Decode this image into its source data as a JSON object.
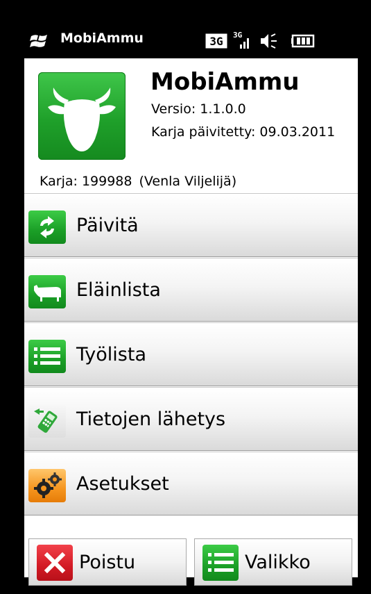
{
  "statusbar": {
    "title": "MobiAmmu",
    "icons": [
      "windows-logo",
      "3g-icon",
      "signal-3g-icon",
      "volume-icon",
      "battery-icon"
    ]
  },
  "app": {
    "name": "MobiAmmu",
    "version_label": "Versio: 1.1.0.0",
    "updated_label": "Karja päivitetty: 09.03.2011",
    "herd_label": "Karja: 199988",
    "herd_owner": "(Venla Viljelijä)",
    "icon": "cow-head-icon"
  },
  "menu": [
    {
      "label": "Päivitä",
      "icon": "refresh-icon"
    },
    {
      "label": "Eläinlista",
      "icon": "cow-icon"
    },
    {
      "label": "Työlista",
      "icon": "list-icon"
    },
    {
      "label": "Tietojen lähetys",
      "icon": "phone-send-icon"
    },
    {
      "label": "Asetukset",
      "icon": "gears-icon"
    }
  ],
  "softkeys": {
    "left": {
      "label": "Poistu",
      "icon": "close-icon"
    },
    "right": {
      "label": "Valikko",
      "icon": "list-icon"
    }
  },
  "colors": {
    "accent_green": "#1fa02a",
    "exit_red": "#d21a24",
    "settings_orange": "#f5951e"
  }
}
